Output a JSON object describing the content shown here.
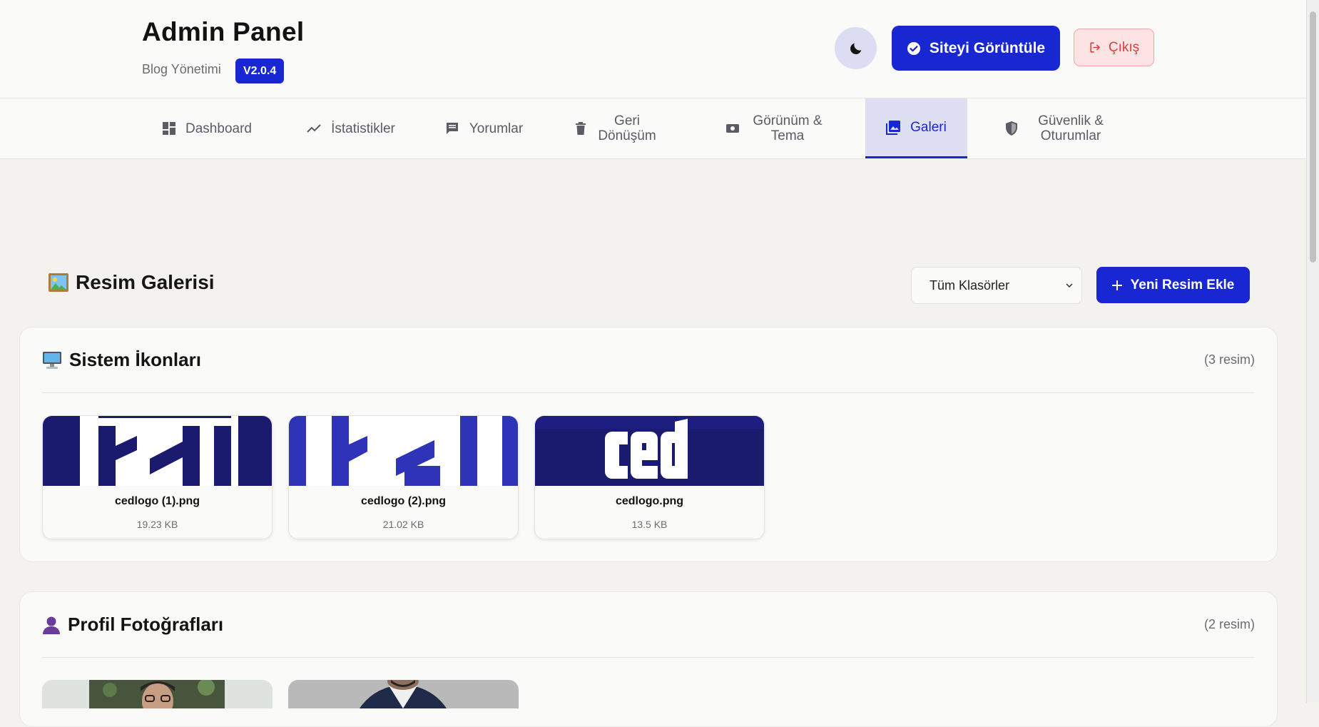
{
  "header": {
    "title": "Admin Panel",
    "subtitle": "Blog Yönetimi",
    "version": "V2.0.4",
    "view_site_label": "Siteyi Görüntüle",
    "logout_label": "Çıkış"
  },
  "nav": {
    "items": [
      {
        "label": "Dashboard",
        "icon": "dashboard-icon"
      },
      {
        "label": "İstatistikler",
        "icon": "trending-chart-icon"
      },
      {
        "label": "Yorumlar",
        "icon": "comment-icon"
      },
      {
        "label": "Geri Dönüşüm",
        "icon": "trash-icon"
      },
      {
        "label": "Görünüm & Tema",
        "icon": "theme-icon"
      },
      {
        "label": "Galeri",
        "icon": "gallery-icon",
        "active": true
      },
      {
        "label": "Güvenlik & Oturumlar",
        "icon": "shield-icon"
      }
    ]
  },
  "gallery": {
    "title": "Resim Galerisi",
    "folder_select_value": "Tüm Klasörler",
    "add_button_label": "Yeni Resim Ekle"
  },
  "folders": [
    {
      "title": "Sistem İkonları",
      "count": "(3 resim)",
      "images": [
        {
          "name": "cedlogo (1).png",
          "size": "19.23 KB"
        },
        {
          "name": "cedlogo (2).png",
          "size": "21.02 KB"
        },
        {
          "name": "cedlogo.png",
          "size": "13.5 KB"
        }
      ]
    },
    {
      "title": "Profil Fotoğrafları",
      "count": "(2 resim)"
    }
  ],
  "colors": {
    "accent": "#1927d3",
    "danger": "#e23b3b",
    "logo_navy": "#1a1a6e",
    "background": "#f3f2ee"
  }
}
